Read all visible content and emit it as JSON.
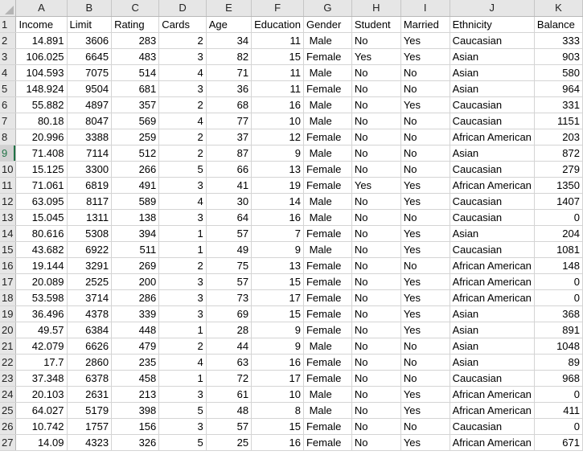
{
  "sheet": {
    "selected_row": 9,
    "columns": [
      "A",
      "B",
      "C",
      "D",
      "E",
      "F",
      "G",
      "H",
      "I",
      "J",
      "K"
    ],
    "headers": [
      "Income",
      "Limit",
      "Rating",
      "Cards",
      "Age",
      "Education",
      "Gender",
      "Student",
      "Married",
      "Ethnicity",
      "Balance"
    ],
    "rows": [
      [
        "14.891",
        "3606",
        "283",
        "2",
        "34",
        "11",
        " Male",
        "No",
        "Yes",
        "Caucasian",
        "333"
      ],
      [
        "106.025",
        "6645",
        "483",
        "3",
        "82",
        "15",
        "Female",
        "Yes",
        "Yes",
        "Asian",
        "903"
      ],
      [
        "104.593",
        "7075",
        "514",
        "4",
        "71",
        "11",
        " Male",
        "No",
        "No",
        "Asian",
        "580"
      ],
      [
        "148.924",
        "9504",
        "681",
        "3",
        "36",
        "11",
        "Female",
        "No",
        "No",
        "Asian",
        "964"
      ],
      [
        "55.882",
        "4897",
        "357",
        "2",
        "68",
        "16",
        " Male",
        "No",
        "Yes",
        "Caucasian",
        "331"
      ],
      [
        "80.18",
        "8047",
        "569",
        "4",
        "77",
        "10",
        " Male",
        "No",
        "No",
        "Caucasian",
        "1151"
      ],
      [
        "20.996",
        "3388",
        "259",
        "2",
        "37",
        "12",
        "Female",
        "No",
        "No",
        "African American",
        "203"
      ],
      [
        "71.408",
        "7114",
        "512",
        "2",
        "87",
        "9",
        " Male",
        "No",
        "No",
        "Asian",
        "872"
      ],
      [
        "15.125",
        "3300",
        "266",
        "5",
        "66",
        "13",
        "Female",
        "No",
        "No",
        "Caucasian",
        "279"
      ],
      [
        "71.061",
        "6819",
        "491",
        "3",
        "41",
        "19",
        "Female",
        "Yes",
        "Yes",
        "African American",
        "1350"
      ],
      [
        "63.095",
        "8117",
        "589",
        "4",
        "30",
        "14",
        " Male",
        "No",
        "Yes",
        "Caucasian",
        "1407"
      ],
      [
        "15.045",
        "1311",
        "138",
        "3",
        "64",
        "16",
        " Male",
        "No",
        "No",
        "Caucasian",
        "0"
      ],
      [
        "80.616",
        "5308",
        "394",
        "1",
        "57",
        "7",
        "Female",
        "No",
        "Yes",
        "Asian",
        "204"
      ],
      [
        "43.682",
        "6922",
        "511",
        "1",
        "49",
        "9",
        " Male",
        "No",
        "Yes",
        "Caucasian",
        "1081"
      ],
      [
        "19.144",
        "3291",
        "269",
        "2",
        "75",
        "13",
        "Female",
        "No",
        "No",
        "African American",
        "148"
      ],
      [
        "20.089",
        "2525",
        "200",
        "3",
        "57",
        "15",
        "Female",
        "No",
        "Yes",
        "African American",
        "0"
      ],
      [
        "53.598",
        "3714",
        "286",
        "3",
        "73",
        "17",
        "Female",
        "No",
        "Yes",
        "African American",
        "0"
      ],
      [
        "36.496",
        "4378",
        "339",
        "3",
        "69",
        "15",
        "Female",
        "No",
        "Yes",
        "Asian",
        "368"
      ],
      [
        "49.57",
        "6384",
        "448",
        "1",
        "28",
        "9",
        "Female",
        "No",
        "Yes",
        "Asian",
        "891"
      ],
      [
        "42.079",
        "6626",
        "479",
        "2",
        "44",
        "9",
        " Male",
        "No",
        "No",
        "Asian",
        "1048"
      ],
      [
        "17.7",
        "2860",
        "235",
        "4",
        "63",
        "16",
        "Female",
        "No",
        "No",
        "Asian",
        "89"
      ],
      [
        "37.348",
        "6378",
        "458",
        "1",
        "72",
        "17",
        "Female",
        "No",
        "No",
        "Caucasian",
        "968"
      ],
      [
        "20.103",
        "2631",
        "213",
        "3",
        "61",
        "10",
        " Male",
        "No",
        "Yes",
        "African American",
        "0"
      ],
      [
        "64.027",
        "5179",
        "398",
        "5",
        "48",
        "8",
        " Male",
        "No",
        "Yes",
        "African American",
        "411"
      ],
      [
        "10.742",
        "1757",
        "156",
        "3",
        "57",
        "15",
        "Female",
        "No",
        "No",
        "Caucasian",
        "0"
      ],
      [
        "14.09",
        "4323",
        "326",
        "5",
        "25",
        "16",
        "Female",
        "No",
        "Yes",
        "African American",
        "671"
      ]
    ],
    "numeric_columns": [
      0,
      1,
      2,
      3,
      4,
      5,
      10
    ]
  }
}
